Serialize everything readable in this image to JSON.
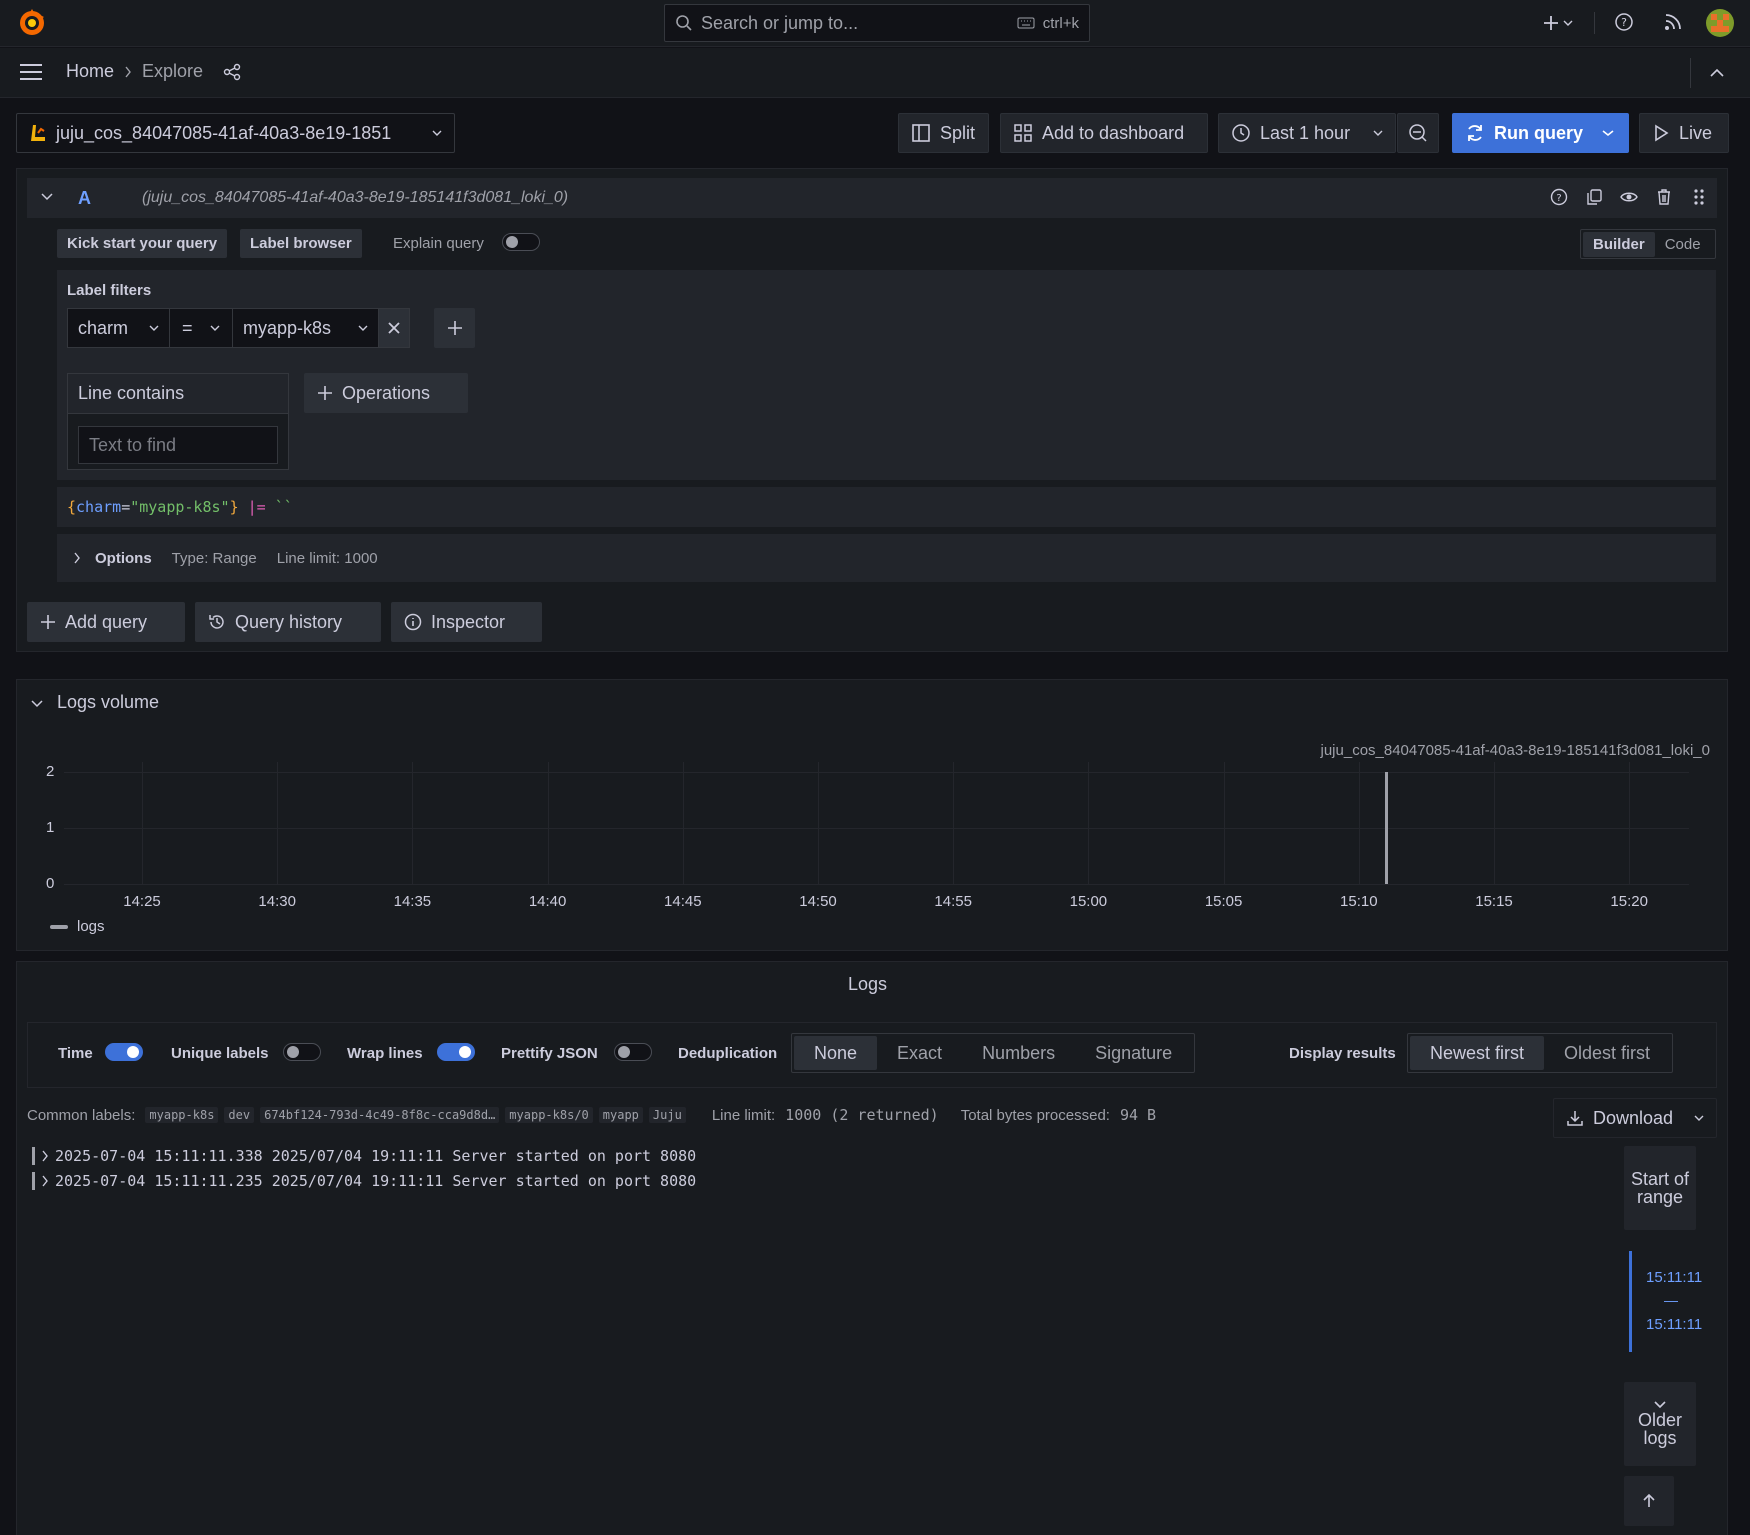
{
  "topbar": {
    "search_placeholder": "Search or jump to...",
    "shortcut": "ctrl+k"
  },
  "breadcrumb": {
    "home": "Home",
    "current": "Explore"
  },
  "toolbar": {
    "datasource": "juju_cos_84047085-41af-40a3-8e19-1851",
    "split": "Split",
    "add_to_dashboard": "Add to dashboard",
    "time_range": "Last 1 hour",
    "run_query": "Run query",
    "live": "Live"
  },
  "query": {
    "letter": "A",
    "datasource_ref": "(juju_cos_84047085-41af-40a3-8e19-185141f3d081_loki_0)",
    "kick_start": "Kick start your query",
    "label_browser": "Label browser",
    "explain_query": "Explain query",
    "mode_builder": "Builder",
    "mode_code": "Code",
    "label_filters_title": "Label filters",
    "filter_label": "charm",
    "filter_op": "=",
    "filter_value": "myapp-k8s",
    "line_contains_title": "Line contains",
    "text_to_find_placeholder": "Text to find",
    "operations": "Operations",
    "preview": {
      "open": "{",
      "key": "charm",
      "eq": "=",
      "val": "\"myapp-k8s\"",
      "close": "}",
      "pipe": " |= ",
      "str": "``"
    },
    "options_label": "Options",
    "options_type": "Type: Range",
    "options_limit": "Line limit: 1000"
  },
  "query_actions": {
    "add_query": "Add query",
    "query_history": "Query history",
    "inspector": "Inspector"
  },
  "logs_volume": {
    "title": "Logs volume",
    "series_label": "juju_cos_84047085-41af-40a3-8e19-185141f3d081_loki_0",
    "legend": "logs"
  },
  "chart_data": {
    "type": "bar",
    "x": [
      "14:25",
      "14:30",
      "14:35",
      "14:40",
      "14:45",
      "14:50",
      "14:55",
      "15:00",
      "15:05",
      "15:10",
      "15:15",
      "15:20"
    ],
    "ylim": [
      0,
      2
    ],
    "yticks": [
      "2",
      "1",
      "0"
    ],
    "series": [
      {
        "name": "logs",
        "points": [
          {
            "x": "15:11",
            "y": 2
          }
        ]
      }
    ],
    "legend_placement": "bottom-left",
    "grid": true
  },
  "logs": {
    "title": "Logs",
    "time": "Time",
    "unique_labels": "Unique labels",
    "wrap_lines": "Wrap lines",
    "prettify_json": "Prettify JSON",
    "dedup_label": "Deduplication",
    "dedup_options": [
      "None",
      "Exact",
      "Numbers",
      "Signature"
    ],
    "display_results": "Display results",
    "newest_first": "Newest first",
    "oldest_first": "Oldest first",
    "common_labels_title": "Common labels:",
    "common_labels": [
      "myapp-k8s",
      "dev",
      "674bf124-793d-4c49-8f8c-cca9d8d…",
      "myapp-k8s/0",
      "myapp",
      "Juju"
    ],
    "line_limit_label": "Line limit:",
    "line_limit_value": "1000 (2 returned)",
    "bytes_label": "Total bytes processed:",
    "bytes_value": "94 B",
    "download": "Download",
    "rows": [
      "2025-07-04 15:11:11.338 2025/07/04 19:11:11 Server started on port 8080",
      "2025-07-04 15:11:11.235 2025/07/04 19:11:11 Server started on port 8080"
    ],
    "start_of_range": "Start of range",
    "range_top": "15:11:11",
    "range_dash": "—",
    "range_bottom": "15:11:11",
    "older_logs": "Older logs"
  }
}
